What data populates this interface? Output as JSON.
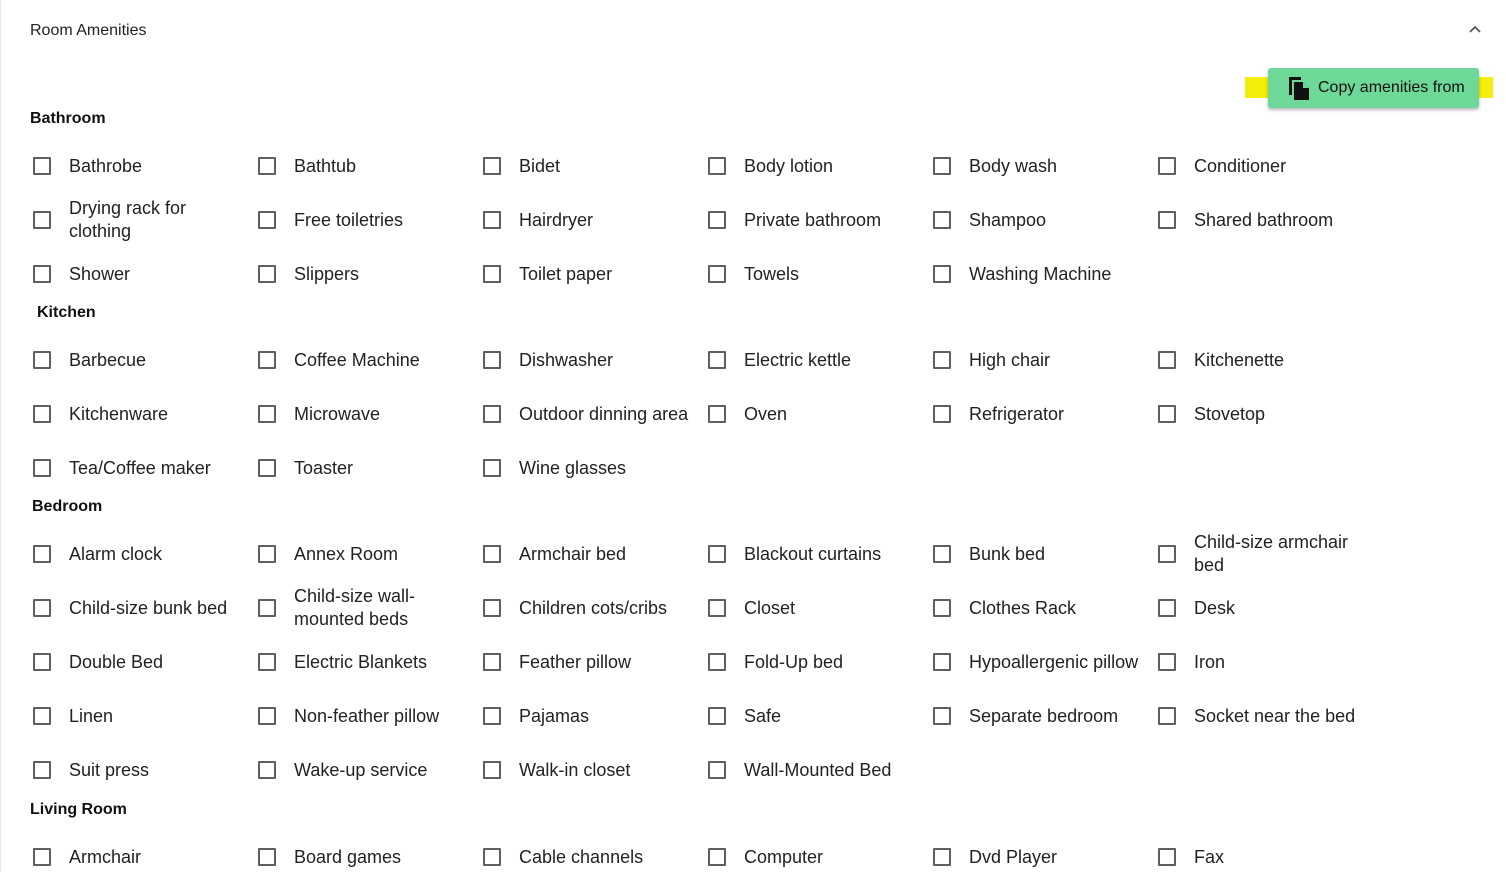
{
  "panel": {
    "title": "Room Amenities",
    "collapse_icon": "chevron-up-icon"
  },
  "copy_button": {
    "label": "Copy amenities from",
    "icon": "copy-icon",
    "color": "#6dd897",
    "highlight_color": "#f5ee0a"
  },
  "sections": [
    {
      "title": "Bathroom",
      "items": [
        {
          "label": "Bathrobe",
          "checked": false
        },
        {
          "label": "Bathtub",
          "checked": false
        },
        {
          "label": "Bidet",
          "checked": false
        },
        {
          "label": "Body lotion",
          "checked": false
        },
        {
          "label": "Body wash",
          "checked": false
        },
        {
          "label": "Conditioner",
          "checked": false
        },
        {
          "label": "Drying rack for clothing",
          "checked": false
        },
        {
          "label": "Free toiletries",
          "checked": false
        },
        {
          "label": "Hairdryer",
          "checked": false
        },
        {
          "label": "Private bathroom",
          "checked": false
        },
        {
          "label": "Shampoo",
          "checked": false
        },
        {
          "label": "Shared bathroom",
          "checked": false
        },
        {
          "label": "Shower",
          "checked": false
        },
        {
          "label": "Slippers",
          "checked": false
        },
        {
          "label": "Toilet paper",
          "checked": false
        },
        {
          "label": "Towels",
          "checked": false
        },
        {
          "label": "Washing Machine",
          "checked": false
        }
      ]
    },
    {
      "title": "Kitchen",
      "items": [
        {
          "label": "Barbecue",
          "checked": false
        },
        {
          "label": "Coffee Machine",
          "checked": false
        },
        {
          "label": "Dishwasher",
          "checked": false
        },
        {
          "label": "Electric kettle",
          "checked": false
        },
        {
          "label": "High chair",
          "checked": false
        },
        {
          "label": "Kitchenette",
          "checked": false
        },
        {
          "label": "Kitchenware",
          "checked": false
        },
        {
          "label": "Microwave",
          "checked": false
        },
        {
          "label": "Outdoor dinning area",
          "checked": false
        },
        {
          "label": "Oven",
          "checked": false
        },
        {
          "label": "Refrigerator",
          "checked": false
        },
        {
          "label": "Stovetop",
          "checked": false
        },
        {
          "label": "Tea/Coffee maker",
          "checked": false
        },
        {
          "label": "Toaster",
          "checked": false
        },
        {
          "label": "Wine glasses",
          "checked": false
        }
      ]
    },
    {
      "title": "Bedroom",
      "items": [
        {
          "label": "Alarm clock",
          "checked": false
        },
        {
          "label": "Annex Room",
          "checked": false
        },
        {
          "label": "Armchair bed",
          "checked": false
        },
        {
          "label": "Blackout curtains",
          "checked": false
        },
        {
          "label": "Bunk bed",
          "checked": false
        },
        {
          "label": "Child-size armchair bed",
          "checked": false
        },
        {
          "label": "Child-size bunk bed",
          "checked": false
        },
        {
          "label": "Child-size wall-mounted beds",
          "checked": false
        },
        {
          "label": "Children cots/cribs",
          "checked": false
        },
        {
          "label": "Closet",
          "checked": false
        },
        {
          "label": "Clothes Rack",
          "checked": false
        },
        {
          "label": "Desk",
          "checked": false
        },
        {
          "label": "Double Bed",
          "checked": false
        },
        {
          "label": "Electric Blankets",
          "checked": false
        },
        {
          "label": "Feather pillow",
          "checked": false
        },
        {
          "label": "Fold-Up bed",
          "checked": false
        },
        {
          "label": "Hypoallergenic pillow",
          "checked": false
        },
        {
          "label": "Iron",
          "checked": false
        },
        {
          "label": "Linen",
          "checked": false
        },
        {
          "label": "Non-feather pillow",
          "checked": false
        },
        {
          "label": "Pajamas",
          "checked": false
        },
        {
          "label": "Safe",
          "checked": false
        },
        {
          "label": "Separate bedroom",
          "checked": false
        },
        {
          "label": "Socket near the bed",
          "checked": false
        },
        {
          "label": "Suit press",
          "checked": false
        },
        {
          "label": "Wake-up service",
          "checked": false
        },
        {
          "label": "Walk-in closet",
          "checked": false
        },
        {
          "label": "Wall-Mounted Bed",
          "checked": false
        }
      ]
    },
    {
      "title": "Living Room",
      "items": [
        {
          "label": "Armchair",
          "checked": false
        },
        {
          "label": "Board games",
          "checked": false
        },
        {
          "label": "Cable channels",
          "checked": false
        },
        {
          "label": "Computer",
          "checked": false
        },
        {
          "label": "Dvd Player",
          "checked": false
        },
        {
          "label": "Fax",
          "checked": false
        }
      ]
    }
  ]
}
